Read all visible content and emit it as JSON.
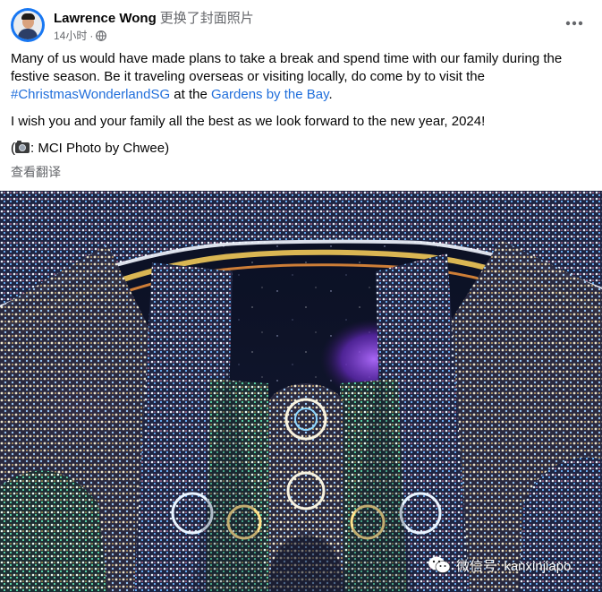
{
  "post": {
    "author": "Lawrence Wong",
    "action": "更换了封面照片",
    "timestamp": "14小时",
    "separator": "·",
    "audience_icon": "globe-icon",
    "more_icon": "more-horizontal-icon",
    "paragraph1_before": "Many of us would have made plans to take a break and spend time with our family during the festive season. Be it traveling overseas or visiting locally, do come by to visit the ",
    "hashtag": "#ChristmasWonderlandSG",
    "paragraph1_middle": " at the ",
    "place_link": "Gardens by the Bay",
    "paragraph1_after": ".",
    "paragraph2": "I wish you and your family all the best as we look forward to the new year, 2024!",
    "credit_open": "(",
    "credit_icon": "camera-icon",
    "credit_text": ": MCI Photo by Chwee)",
    "translate_label": "查看翻译"
  },
  "photo": {
    "watermark_icon": "wechat-icon",
    "watermark_text": "微信号: kanxinjiapo"
  },
  "colors": {
    "link": "#216fdb",
    "secondary_text": "#65676b",
    "primary_text": "#050505"
  }
}
